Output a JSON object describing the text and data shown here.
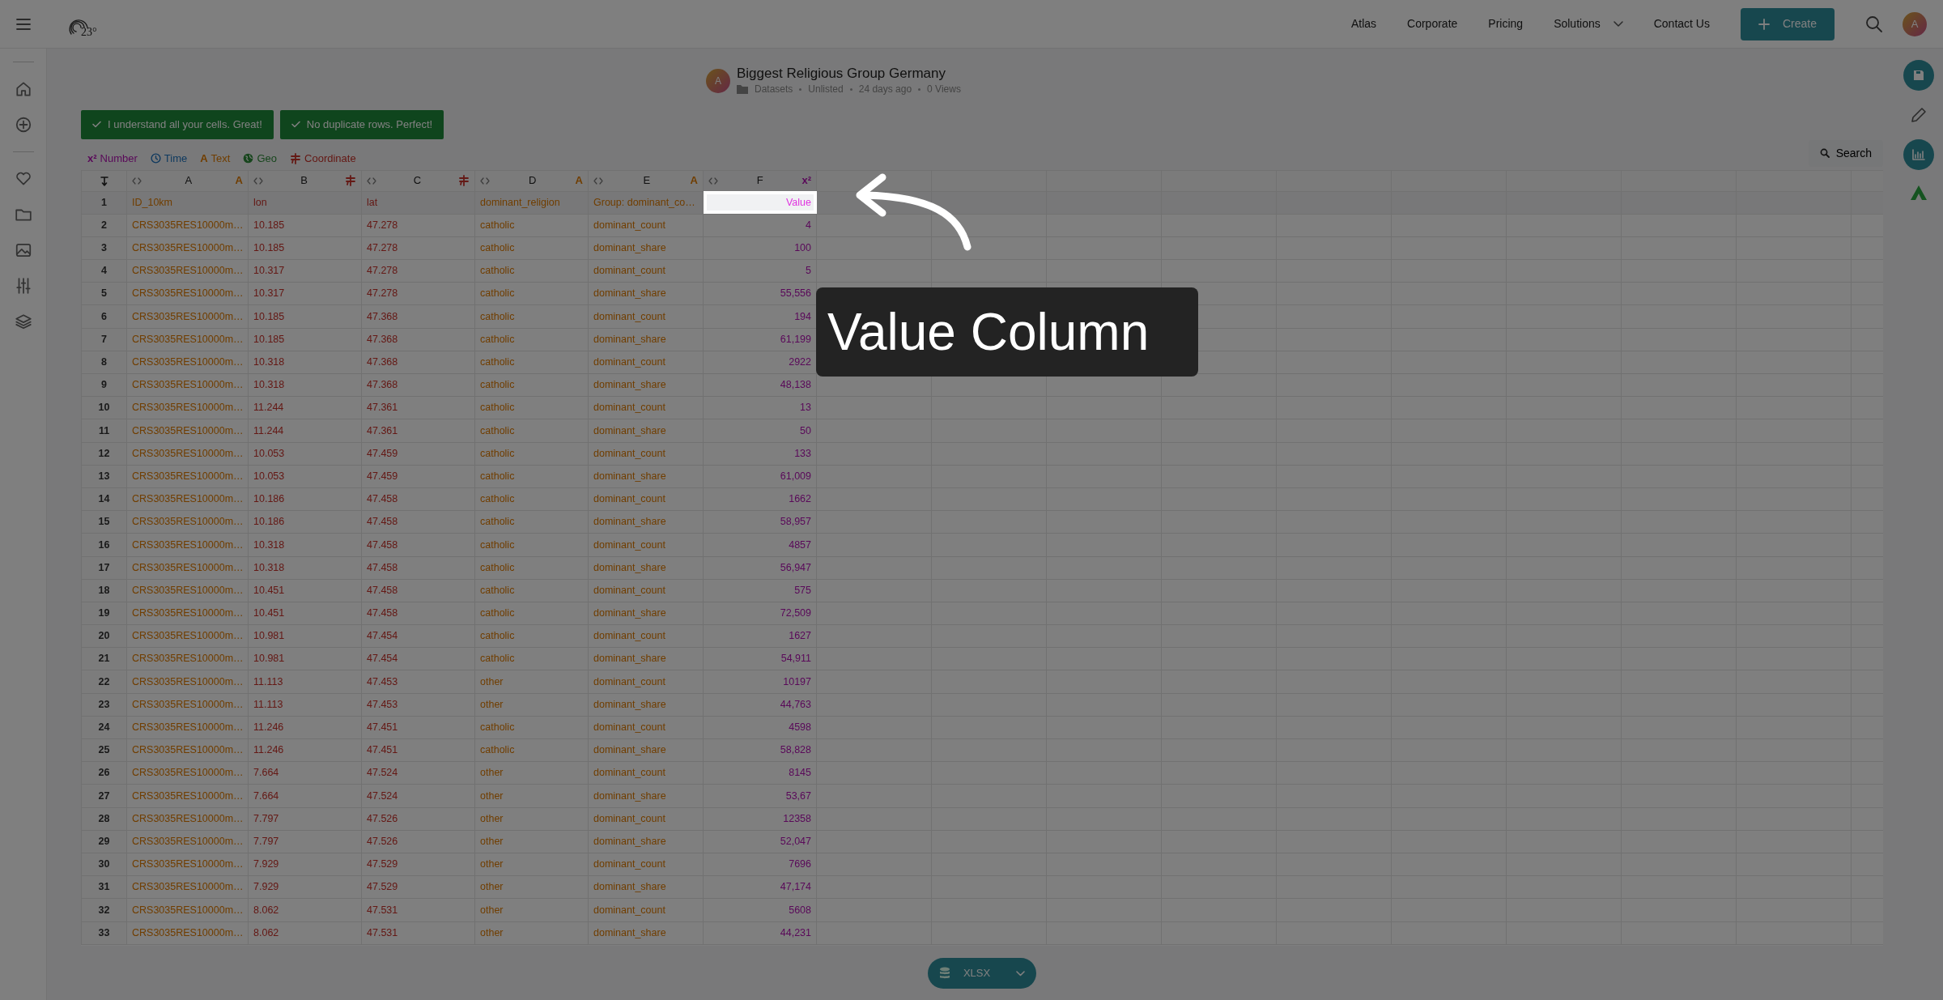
{
  "nav": {
    "logo_text": "23°",
    "links": [
      {
        "label": "Atlas",
        "dropdown": false
      },
      {
        "label": "Corporate",
        "dropdown": false
      },
      {
        "label": "Pricing",
        "dropdown": false
      },
      {
        "label": "Solutions",
        "dropdown": true
      },
      {
        "label": "Contact Us",
        "dropdown": false
      }
    ],
    "create_button": "Create",
    "avatar": "A"
  },
  "dataset": {
    "avatar": "A",
    "title": "Biggest Religious Group Germany",
    "meta": [
      "Datasets",
      "Unlisted",
      "24 days ago",
      "0 Views"
    ]
  },
  "checks": [
    "I understand all your cells. Great!",
    "No duplicate rows. Perfect!"
  ],
  "types": [
    {
      "kind": "number",
      "symbol": "x²",
      "label": "Number"
    },
    {
      "kind": "time",
      "label": "Time"
    },
    {
      "kind": "text",
      "symbol": "A",
      "label": "Text"
    },
    {
      "kind": "geo",
      "label": "Geo"
    },
    {
      "kind": "coordinate",
      "label": "Coordinate"
    }
  ],
  "search_button": "Search",
  "columns": [
    {
      "letter": "A",
      "kind": "text",
      "symbol": "A",
      "highlighted": false
    },
    {
      "letter": "B",
      "kind": "coordinate",
      "highlighted": false
    },
    {
      "letter": "C",
      "kind": "coordinate",
      "highlighted": false
    },
    {
      "letter": "D",
      "kind": "text",
      "symbol": "A",
      "highlighted": false
    },
    {
      "letter": "E",
      "kind": "text",
      "symbol": "A",
      "highlighted": false
    },
    {
      "letter": "F",
      "kind": "number",
      "symbol": "x²",
      "highlighted": true
    }
  ],
  "header_row": {
    "number": "1",
    "cells": [
      "ID_10km",
      "lon",
      "lat",
      "dominant_religion",
      "Group: dominant_co…",
      "Value"
    ]
  },
  "rows": [
    {
      "number": "2",
      "cells": [
        "CRS3035RES10000m…",
        "10.185",
        "47.278",
        "catholic",
        "dominant_count",
        "4"
      ]
    },
    {
      "number": "3",
      "cells": [
        "CRS3035RES10000m…",
        "10.185",
        "47.278",
        "catholic",
        "dominant_share",
        "100"
      ]
    },
    {
      "number": "4",
      "cells": [
        "CRS3035RES10000m…",
        "10.317",
        "47.278",
        "catholic",
        "dominant_count",
        "5"
      ]
    },
    {
      "number": "5",
      "cells": [
        "CRS3035RES10000m…",
        "10.317",
        "47.278",
        "catholic",
        "dominant_share",
        "55,556"
      ]
    },
    {
      "number": "6",
      "cells": [
        "CRS3035RES10000m…",
        "10.185",
        "47.368",
        "catholic",
        "dominant_count",
        "194"
      ]
    },
    {
      "number": "7",
      "cells": [
        "CRS3035RES10000m…",
        "10.185",
        "47.368",
        "catholic",
        "dominant_share",
        "61,199"
      ]
    },
    {
      "number": "8",
      "cells": [
        "CRS3035RES10000m…",
        "10.318",
        "47.368",
        "catholic",
        "dominant_count",
        "2922"
      ]
    },
    {
      "number": "9",
      "cells": [
        "CRS3035RES10000m…",
        "10.318",
        "47.368",
        "catholic",
        "dominant_share",
        "48,138"
      ]
    },
    {
      "number": "10",
      "cells": [
        "CRS3035RES10000m…",
        "11.244",
        "47.361",
        "catholic",
        "dominant_count",
        "13"
      ]
    },
    {
      "number": "11",
      "cells": [
        "CRS3035RES10000m…",
        "11.244",
        "47.361",
        "catholic",
        "dominant_share",
        "50"
      ]
    },
    {
      "number": "12",
      "cells": [
        "CRS3035RES10000m…",
        "10.053",
        "47.459",
        "catholic",
        "dominant_count",
        "133"
      ]
    },
    {
      "number": "13",
      "cells": [
        "CRS3035RES10000m…",
        "10.053",
        "47.459",
        "catholic",
        "dominant_share",
        "61,009"
      ]
    },
    {
      "number": "14",
      "cells": [
        "CRS3035RES10000m…",
        "10.186",
        "47.458",
        "catholic",
        "dominant_count",
        "1662"
      ]
    },
    {
      "number": "15",
      "cells": [
        "CRS3035RES10000m…",
        "10.186",
        "47.458",
        "catholic",
        "dominant_share",
        "58,957"
      ]
    },
    {
      "number": "16",
      "cells": [
        "CRS3035RES10000m…",
        "10.318",
        "47.458",
        "catholic",
        "dominant_count",
        "4857"
      ]
    },
    {
      "number": "17",
      "cells": [
        "CRS3035RES10000m…",
        "10.318",
        "47.458",
        "catholic",
        "dominant_share",
        "56,947"
      ]
    },
    {
      "number": "18",
      "cells": [
        "CRS3035RES10000m…",
        "10.451",
        "47.458",
        "catholic",
        "dominant_count",
        "575"
      ]
    },
    {
      "number": "19",
      "cells": [
        "CRS3035RES10000m…",
        "10.451",
        "47.458",
        "catholic",
        "dominant_share",
        "72,509"
      ]
    },
    {
      "number": "20",
      "cells": [
        "CRS3035RES10000m…",
        "10.981",
        "47.454",
        "catholic",
        "dominant_count",
        "1627"
      ]
    },
    {
      "number": "21",
      "cells": [
        "CRS3035RES10000m…",
        "10.981",
        "47.454",
        "catholic",
        "dominant_share",
        "54,911"
      ]
    },
    {
      "number": "22",
      "cells": [
        "CRS3035RES10000m…",
        "11.113",
        "47.453",
        "other",
        "dominant_count",
        "10197"
      ]
    },
    {
      "number": "23",
      "cells": [
        "CRS3035RES10000m…",
        "11.113",
        "47.453",
        "other",
        "dominant_share",
        "44,763"
      ]
    },
    {
      "number": "24",
      "cells": [
        "CRS3035RES10000m…",
        "11.246",
        "47.451",
        "catholic",
        "dominant_count",
        "4598"
      ]
    },
    {
      "number": "25",
      "cells": [
        "CRS3035RES10000m…",
        "11.246",
        "47.451",
        "catholic",
        "dominant_share",
        "58,828"
      ]
    },
    {
      "number": "26",
      "cells": [
        "CRS3035RES10000m…",
        "7.664",
        "47.524",
        "other",
        "dominant_count",
        "8145"
      ]
    },
    {
      "number": "27",
      "cells": [
        "CRS3035RES10000m…",
        "7.664",
        "47.524",
        "other",
        "dominant_share",
        "53,67"
      ]
    },
    {
      "number": "28",
      "cells": [
        "CRS3035RES10000m…",
        "7.797",
        "47.526",
        "other",
        "dominant_count",
        "12358"
      ]
    },
    {
      "number": "29",
      "cells": [
        "CRS3035RES10000m…",
        "7.797",
        "47.526",
        "other",
        "dominant_share",
        "52,047"
      ]
    },
    {
      "number": "30",
      "cells": [
        "CRS3035RES10000m…",
        "7.929",
        "47.529",
        "other",
        "dominant_count",
        "7696"
      ]
    },
    {
      "number": "31",
      "cells": [
        "CRS3035RES10000m…",
        "7.929",
        "47.529",
        "other",
        "dominant_share",
        "47,174"
      ]
    },
    {
      "number": "32",
      "cells": [
        "CRS3035RES10000m…",
        "8.062",
        "47.531",
        "other",
        "dominant_count",
        "5608"
      ]
    },
    {
      "number": "33",
      "cells": [
        "CRS3035RES10000m…",
        "8.062",
        "47.531",
        "other",
        "dominant_share",
        "44,231"
      ]
    }
  ],
  "export_button": "XLSX",
  "tutorial": {
    "label": "Value Column"
  }
}
